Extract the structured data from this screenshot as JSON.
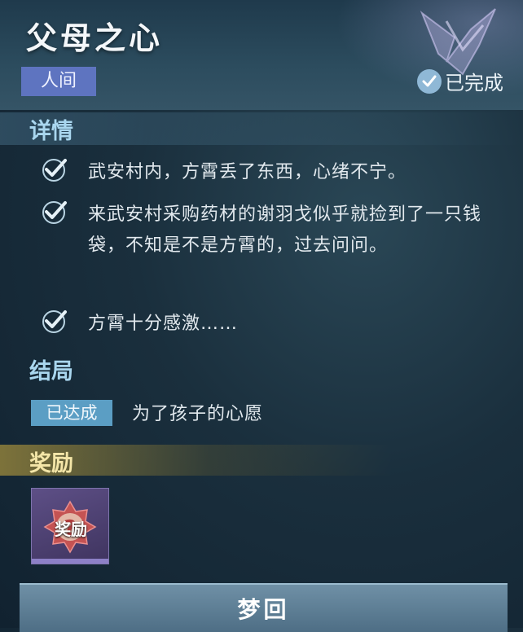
{
  "quest": {
    "title": "父母之心",
    "region": "人间",
    "status": "已完成"
  },
  "details": {
    "heading": "详情",
    "items": [
      {
        "text": "武安村内，方霄丢了东西，心绪不宁。",
        "done": true
      },
      {
        "text": "来武安村采购药材的谢羽戈似乎就捡到了一只钱袋，不知是不是方霄的，过去问问。",
        "done": true
      },
      {
        "text": "方霄十分感激……",
        "done": true
      }
    ]
  },
  "ending": {
    "heading": "结局",
    "badge": "已达成",
    "text": "为了孩子的心愿"
  },
  "reward": {
    "heading": "奖励",
    "item_label": "奖励",
    "icon": "mystery-question-icon"
  },
  "actions": {
    "dream_label": "梦回"
  },
  "colors": {
    "region_tag": "#5e74c0",
    "ending_badge": "#5b9ec4",
    "check": "#8fb8d6",
    "reward_gold": "#f4e6a8"
  }
}
